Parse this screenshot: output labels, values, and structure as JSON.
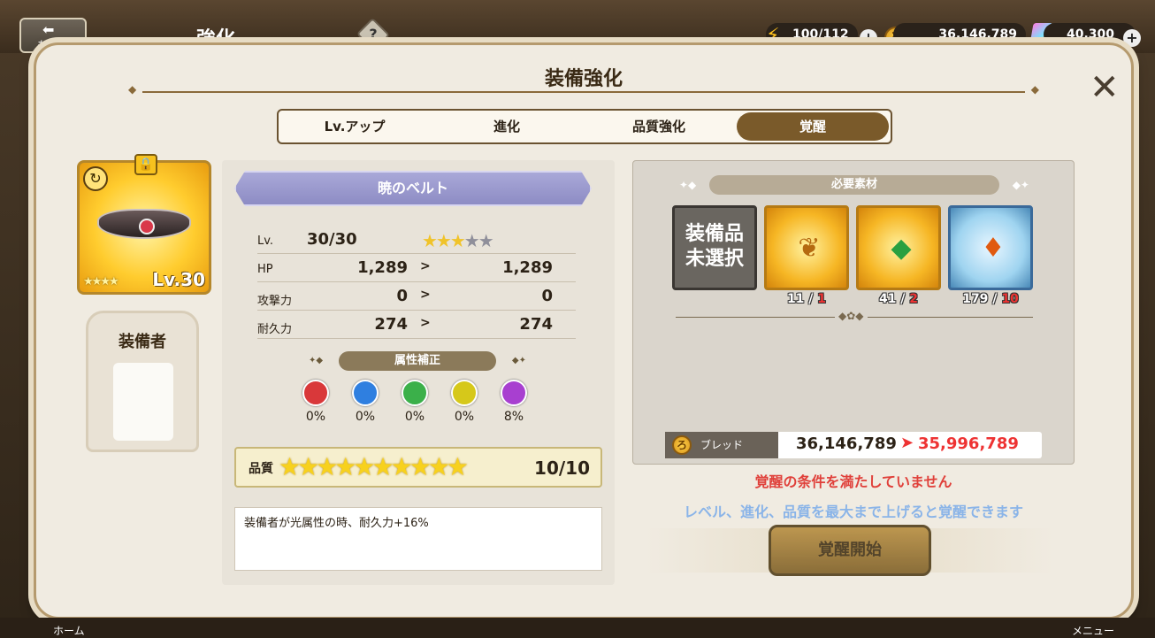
{
  "topbar": {
    "back_label": "もどる",
    "screen_title": "強化",
    "help_icon": "?",
    "stamina": "100/112",
    "gold": "36,146,789",
    "gems": "40,300"
  },
  "dialog": {
    "title": "装備強化",
    "tabs": [
      {
        "label": "Lv.アップ",
        "active": false
      },
      {
        "label": "進化",
        "active": false
      },
      {
        "label": "品質強化",
        "active": false
      },
      {
        "label": "覚醒",
        "active": true
      }
    ]
  },
  "item": {
    "level_badge": "Lv.30",
    "equipper_label": "装備者",
    "name": "暁のベルト",
    "stars_total": 5,
    "stars_filled": 3
  },
  "stats": {
    "lv_label": "Lv.",
    "lv_value": "30/30",
    "rows": [
      {
        "label": "HP",
        "before": "1,289",
        "after": "1,289"
      },
      {
        "label": "攻撃力",
        "before": "0",
        "after": "0"
      },
      {
        "label": "耐久力",
        "before": "274",
        "after": "274"
      }
    ]
  },
  "attributes": {
    "header": "属性補正",
    "items": [
      {
        "icon": "fire-orb-icon",
        "color": "#d9383a",
        "value": "0%"
      },
      {
        "icon": "water-orb-icon",
        "color": "#2f7fe0",
        "value": "0%"
      },
      {
        "icon": "wind-orb-icon",
        "color": "#3bb04a",
        "value": "0%"
      },
      {
        "icon": "light-orb-icon",
        "color": "#d6c81a",
        "value": "0%"
      },
      {
        "icon": "dark-orb-icon",
        "color": "#a83fd0",
        "value": "8%"
      }
    ]
  },
  "quality": {
    "label": "品質",
    "value": "10/10",
    "stars": 10
  },
  "description": "装備者が光属性の時、耐久力+16%",
  "materials": {
    "header": "必要素材",
    "unselected_label_line1": "装備品",
    "unselected_label_line2": "未選択",
    "items": [
      {
        "icon": "heart-crest-icon",
        "have": "11",
        "need": "1"
      },
      {
        "icon": "green-flame-gem-icon",
        "have": "41",
        "need": "2"
      },
      {
        "icon": "blue-flame-gem-icon",
        "have": "179",
        "need": "10"
      }
    ]
  },
  "cost": {
    "label": "ブレッド",
    "current": "36,146,789",
    "after": "35,996,789"
  },
  "messages": {
    "warning": "覚醒の条件を満たしていません",
    "hint": "レベル、進化、品質を最大まで上げると覚醒できます"
  },
  "action_button": "覚醒開始",
  "bottom": {
    "home": "ホーム",
    "menu": "メニュー"
  }
}
